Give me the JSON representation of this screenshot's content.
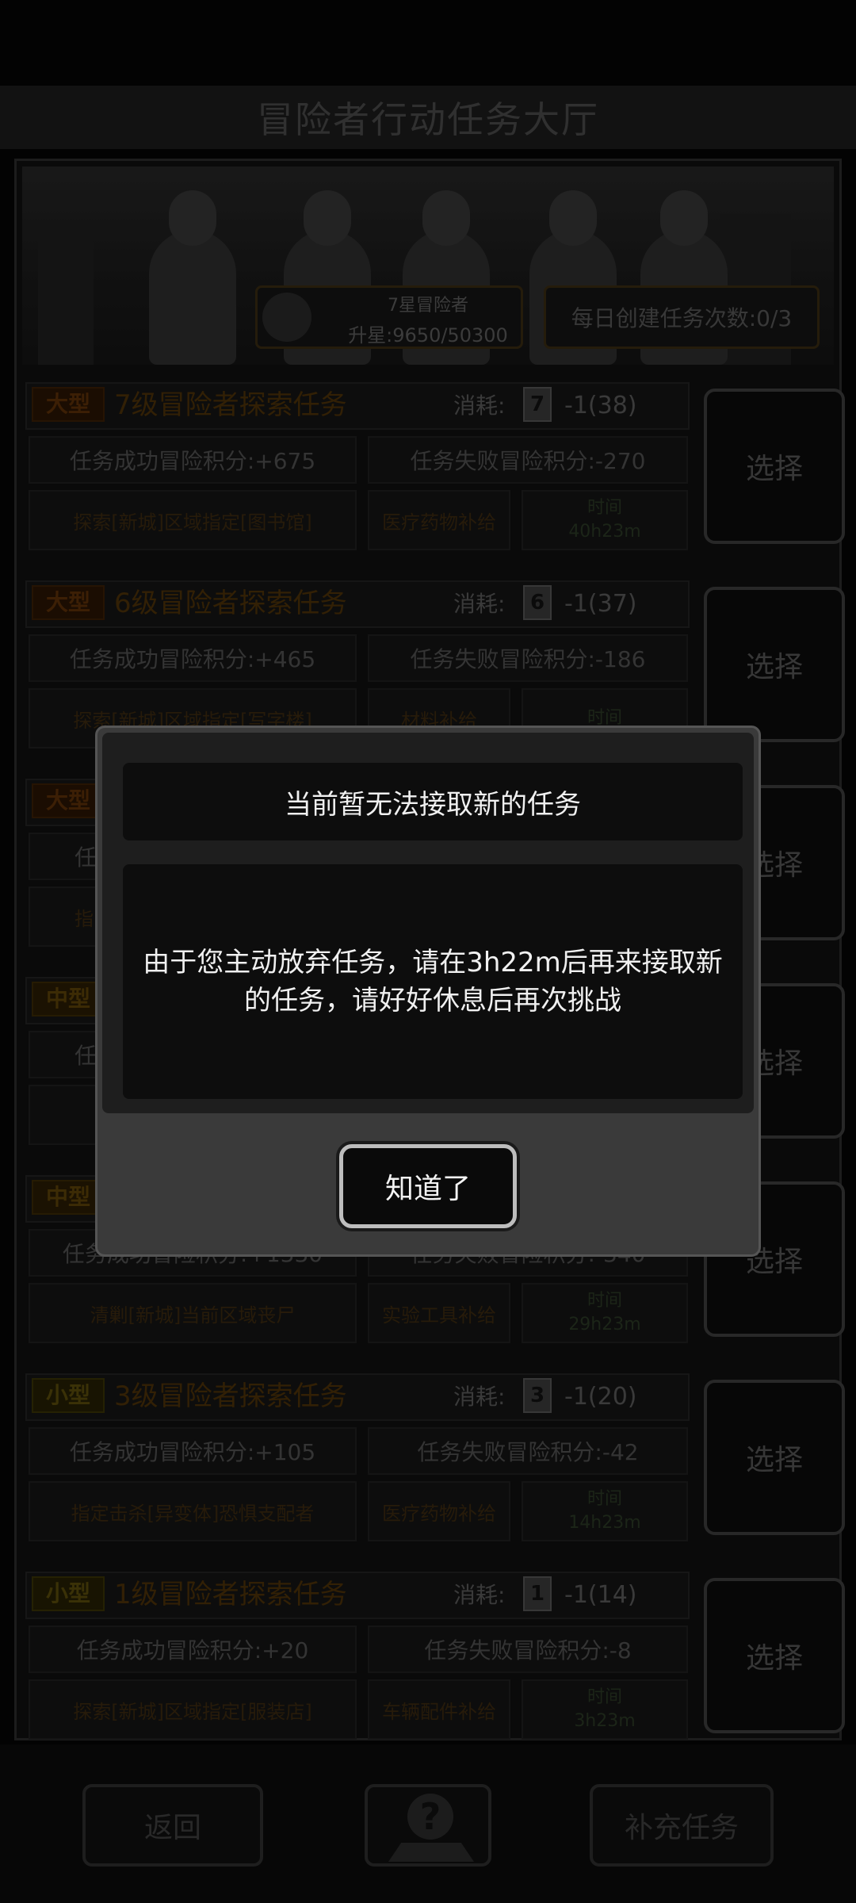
{
  "header": {
    "title": "冒险者行动任务大厅"
  },
  "rank": {
    "name": "7星冒险者",
    "progress": "升星:9650/50300"
  },
  "daily": {
    "label": "每日创建任务次数:0/3"
  },
  "cost_label": "消耗:",
  "select_label": "选择",
  "time_label": "时间",
  "tasks": [
    {
      "size": "大型",
      "title": "7级冒险者探索任务",
      "card": "7",
      "cost": "-1(38)",
      "success": "任务成功冒险积分:+675",
      "fail": "任务失败冒险积分:-270",
      "target": "探索[新城]区域指定[图书馆]",
      "reward": "医疗药物补给",
      "time": "40h23m"
    },
    {
      "size": "大型",
      "title": "6级冒险者探索任务",
      "card": "6",
      "cost": "-1(37)",
      "success": "任务成功冒险积分:+465",
      "fail": "任务失败冒险积分:-186",
      "target": "探索[新城]区域指定[写字楼]",
      "reward": "材料补给",
      "time": ""
    },
    {
      "size": "大型",
      "title": "",
      "card": "",
      "cost": "",
      "success": "任",
      "fail": "",
      "target": "指",
      "reward": "",
      "time": ""
    },
    {
      "size": "中型",
      "title": "",
      "card": "",
      "cost": "",
      "success": "任",
      "fail": "",
      "target": "",
      "reward": "",
      "time": ""
    },
    {
      "size": "中型",
      "title": "",
      "card": "",
      "cost": "",
      "success": "任务成功冒险积分:+1330",
      "fail": "任务失败冒险积分:-340",
      "target": "清剿[新城]当前区域丧尸",
      "reward": "实验工具补给",
      "time": "29h23m"
    },
    {
      "size": "小型",
      "title": "3级冒险者探索任务",
      "card": "3",
      "cost": "-1(20)",
      "success": "任务成功冒险积分:+105",
      "fail": "任务失败冒险积分:-42",
      "target": "指定击杀[异变体]恐惧支配者",
      "reward": "医疗药物补给",
      "time": "14h23m"
    },
    {
      "size": "小型",
      "title": "1级冒险者探索任务",
      "card": "1",
      "cost": "-1(14)",
      "success": "任务成功冒险积分:+20",
      "fail": "任务失败冒险积分:-8",
      "target": "探索[新城]区域指定[服装店]",
      "reward": "车辆配件补给",
      "time": "3h23m"
    }
  ],
  "footer": {
    "back": "返回",
    "supplement": "补充任务",
    "help_icon": "question-map-pin-icon"
  },
  "modal": {
    "title": "当前暂无法接取新的任务",
    "message": "由于您主动放弃任务，请在3h22m后再来接取新的任务，请好好休息后再次挑战",
    "ok": "知道了"
  }
}
